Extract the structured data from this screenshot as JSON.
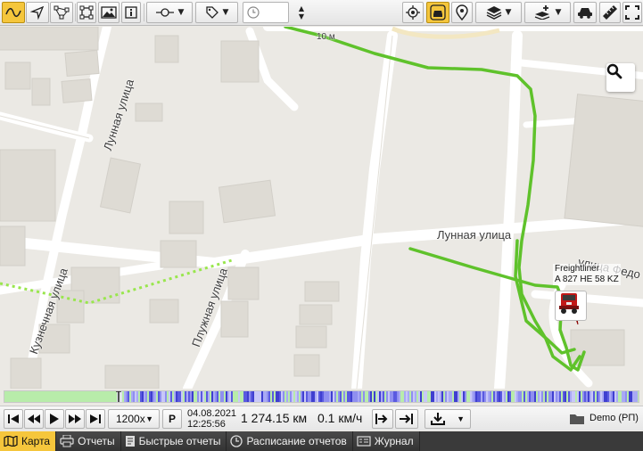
{
  "toolbar": {
    "items": [
      {
        "name": "track-tool-button",
        "icon": "wave-icon",
        "active": true
      },
      {
        "name": "navigate-tool-button",
        "icon": "navigation-arrow-icon",
        "active": false
      },
      {
        "name": "route-tool-button",
        "icon": "route-nodes-icon",
        "active": false
      },
      {
        "name": "geofence-tool-button",
        "icon": "square-shape-icon",
        "active": false
      },
      {
        "name": "image-tool-button",
        "icon": "image-icon",
        "active": false
      },
      {
        "name": "info-tool-button",
        "icon": "info-icon",
        "active": false
      }
    ],
    "line_style_icon": "line-point-icon",
    "tag_icon": "tag-icon",
    "time_icon": "clock-icon",
    "time_value": "",
    "right_items": [
      {
        "name": "locate-button",
        "icon": "crosshair-icon"
      },
      {
        "name": "follow-unit-button",
        "icon": "car-frame-icon",
        "active": true
      },
      {
        "name": "location-pin-button",
        "icon": "map-pin-icon"
      },
      {
        "name": "layers-button",
        "icon": "layers-icon"
      },
      {
        "name": "add-layer-button",
        "icon": "layers-add-icon"
      },
      {
        "name": "vehicle-button",
        "icon": "car-icon"
      },
      {
        "name": "ruler-button",
        "icon": "ruler-icon"
      },
      {
        "name": "fullscreen-button",
        "icon": "fullscreen-icon"
      }
    ]
  },
  "map": {
    "streets": {
      "lunnaya_upper": "Лунная улица",
      "lunnaya_lower": "Лунная улица",
      "kuznechnaya": "Кузнечная улица",
      "pluzhnaya": "Плужная улица",
      "feodosiya": "улица Федо"
    },
    "scale_text": "10 м",
    "search_icon": "search-icon",
    "unit": {
      "name": "Freightliner",
      "plate": "A 827 HE 58 KZ",
      "icon": "truck-icon",
      "direction_icon": "direction-arrow-icon"
    },
    "colors": {
      "track": "#66cc33",
      "track_dotted": "#99e64d",
      "direction_marker": "#e01010",
      "accent": "#f5c63c"
    }
  },
  "player": {
    "first_icon": "skip-start-icon",
    "prev_icon": "rewind-icon",
    "play_icon": "play-icon",
    "next_icon": "fast-forward-icon",
    "last_icon": "skip-end-icon",
    "speed": "1200x",
    "p_label": "P",
    "date": "04.08.2021",
    "time": "12:25:56",
    "mileage": "1 274.15 км",
    "current_speed": "0.1 км/ч",
    "step_in_icon": "arrow-to-line-icon",
    "step_end_icon": "arrow-right-bar-icon",
    "export_icon": "download-icon",
    "account_icon": "folder-icon",
    "account": "Demo (РП)"
  },
  "tabs": [
    {
      "label": "Карта",
      "icon": "map-icon",
      "active": true
    },
    {
      "label": "Отчеты",
      "icon": "printer-icon",
      "active": false
    },
    {
      "label": "Быстрые отчеты",
      "icon": "report-icon",
      "active": false
    },
    {
      "label": "Расписание отчетов",
      "icon": "clock-icon",
      "active": false
    },
    {
      "label": "Журнал",
      "icon": "log-icon",
      "active": false
    }
  ]
}
